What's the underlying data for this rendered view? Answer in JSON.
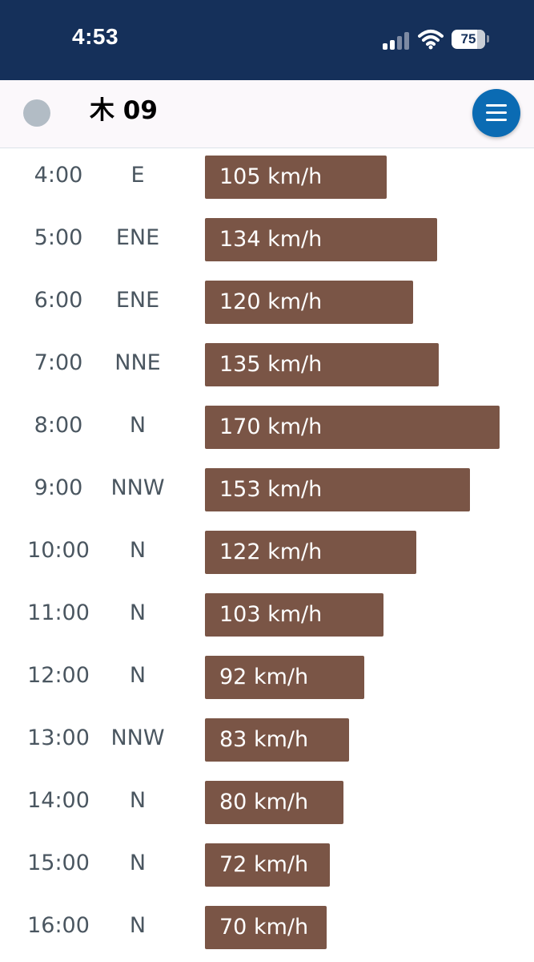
{
  "status_bar": {
    "time": "4:53",
    "battery": "75",
    "icons": [
      "cellular-signal-icon",
      "wifi-icon",
      "battery-icon"
    ]
  },
  "header": {
    "day": "木 09",
    "menu_icon": "hamburger-menu-icon"
  },
  "colors": {
    "status_bar": "#15305a",
    "header_bg": "#fbf8fb",
    "bar": "#7a5546",
    "menu_button": "#0b6bb3",
    "text": "#4a5660"
  },
  "wind": {
    "max_speed": 170,
    "rows": [
      {
        "time": "4:00",
        "direction": "E",
        "speed": 105,
        "label": "105 km/h"
      },
      {
        "time": "5:00",
        "direction": "ENE",
        "speed": 134,
        "label": "134 km/h"
      },
      {
        "time": "6:00",
        "direction": "ENE",
        "speed": 120,
        "label": "120 km/h"
      },
      {
        "time": "7:00",
        "direction": "NNE",
        "speed": 135,
        "label": "135 km/h"
      },
      {
        "time": "8:00",
        "direction": "N",
        "speed": 170,
        "label": "170 km/h"
      },
      {
        "time": "9:00",
        "direction": "NNW",
        "speed": 153,
        "label": "153 km/h"
      },
      {
        "time": "10:00",
        "direction": "N",
        "speed": 122,
        "label": "122 km/h"
      },
      {
        "time": "11:00",
        "direction": "N",
        "speed": 103,
        "label": "103 km/h"
      },
      {
        "time": "12:00",
        "direction": "N",
        "speed": 92,
        "label": "92 km/h"
      },
      {
        "time": "13:00",
        "direction": "NNW",
        "speed": 83,
        "label": "83 km/h"
      },
      {
        "time": "14:00",
        "direction": "N",
        "speed": 80,
        "label": "80 km/h"
      },
      {
        "time": "15:00",
        "direction": "N",
        "speed": 72,
        "label": "72 km/h"
      },
      {
        "time": "16:00",
        "direction": "N",
        "speed": 70,
        "label": "70 km/h"
      }
    ]
  }
}
